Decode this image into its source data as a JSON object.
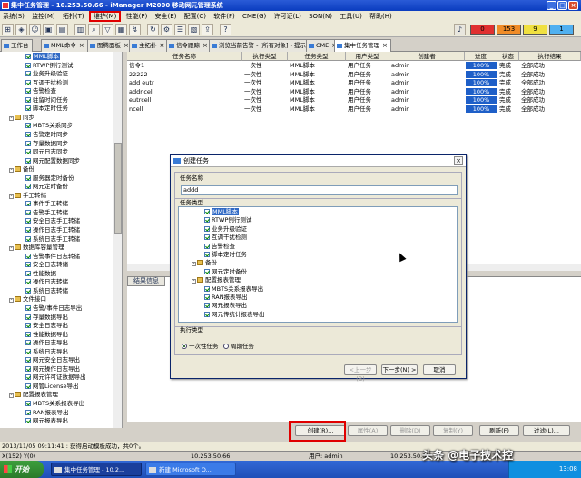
{
  "window": {
    "title": "集中任务管理 - 10.253.50.66 - iManager M2000 移动网元管理系统"
  },
  "menu": [
    "系统(S)",
    "监控(M)",
    "拓扑(T)",
    "维护(M)",
    "性能(P)",
    "安全(E)",
    "配置(C)",
    "软件(F)",
    "CME(G)",
    "许可证(L)",
    "SON(N)",
    "工具(U)",
    "帮助(H)"
  ],
  "alarm_counts": [
    {
      "value": "0",
      "color": "#e03030"
    },
    {
      "value": "153",
      "color": "#f08c28"
    },
    {
      "value": "9",
      "color": "#f0e040"
    },
    {
      "value": "1",
      "color": "#50b0f0"
    }
  ],
  "tabs": [
    {
      "label": "工作台"
    },
    {
      "label": "MML命令"
    },
    {
      "label": "图腾面板"
    },
    {
      "label": "主拓扑"
    },
    {
      "label": "信令跟踪"
    },
    {
      "label": "浏览当前告警 - [所有对象] - 提示"
    },
    {
      "label": "CME"
    },
    {
      "label": "集中任务管理"
    }
  ],
  "tree": [
    {
      "label": "MML脚本",
      "kind": "leaf",
      "sel": true
    },
    {
      "label": "RTWP例行测试",
      "kind": "leaf"
    },
    {
      "label": "业务升级验证",
      "kind": "leaf"
    },
    {
      "label": "互调干扰检测",
      "kind": "leaf"
    },
    {
      "label": "告警检查",
      "kind": "leaf"
    },
    {
      "label": "驻留时间任务",
      "kind": "leaf"
    },
    {
      "label": "脚本定时任务",
      "kind": "leaf"
    },
    {
      "label": "同步",
      "kind": "folder"
    },
    {
      "label": "MBTS关系同步",
      "kind": "leaf"
    },
    {
      "label": "告警定时同步",
      "kind": "leaf"
    },
    {
      "label": "存量数据同步",
      "kind": "leaf"
    },
    {
      "label": "同元日志同步",
      "kind": "leaf"
    },
    {
      "label": "网元配置数据同步",
      "kind": "leaf"
    },
    {
      "label": "备份",
      "kind": "folder"
    },
    {
      "label": "服务器定时备份",
      "kind": "leaf"
    },
    {
      "label": "网元定时备份",
      "kind": "leaf"
    },
    {
      "label": "手工转储",
      "kind": "folder"
    },
    {
      "label": "事件手工转储",
      "kind": "leaf"
    },
    {
      "label": "告警手工转储",
      "kind": "leaf"
    },
    {
      "label": "安全日志手工转储",
      "kind": "leaf"
    },
    {
      "label": "操作日志手工转储",
      "kind": "leaf"
    },
    {
      "label": "系统日志手工转储",
      "kind": "leaf"
    },
    {
      "label": "数据库容量管理",
      "kind": "folder"
    },
    {
      "label": "告警事件日志转储",
      "kind": "leaf"
    },
    {
      "label": "安全日志转储",
      "kind": "leaf"
    },
    {
      "label": "性能数据",
      "kind": "leaf"
    },
    {
      "label": "操作日志转储",
      "kind": "leaf"
    },
    {
      "label": "系统日志转储",
      "kind": "leaf"
    },
    {
      "label": "文件接口",
      "kind": "folder"
    },
    {
      "label": "告警/事件日志导出",
      "kind": "leaf"
    },
    {
      "label": "存量数据导出",
      "kind": "leaf"
    },
    {
      "label": "安全日志导出",
      "kind": "leaf"
    },
    {
      "label": "性能数据导出",
      "kind": "leaf"
    },
    {
      "label": "操作日志导出",
      "kind": "leaf"
    },
    {
      "label": "系统日志导出",
      "kind": "leaf"
    },
    {
      "label": "网元安全日志导出",
      "kind": "leaf"
    },
    {
      "label": "网元操作日志导出",
      "kind": "leaf"
    },
    {
      "label": "网元许可证数据导出",
      "kind": "leaf"
    },
    {
      "label": "网管License导出",
      "kind": "leaf"
    },
    {
      "label": "配置报表管理",
      "kind": "folder"
    },
    {
      "label": "MBTS关系报表导出",
      "kind": "leaf"
    },
    {
      "label": "RAN报表导出",
      "kind": "leaf"
    },
    {
      "label": "网元报表导出",
      "kind": "leaf"
    }
  ],
  "table": {
    "headers": [
      "任务名称",
      "执行类型",
      "任务类型",
      "用户类型",
      "创建者",
      "进度",
      "状态",
      "执行结果"
    ],
    "rows": [
      [
        "信令1",
        "一次性",
        "MML脚本",
        "用户任务",
        "admin",
        "100%",
        "完成",
        "全部成功"
      ],
      [
        "22222",
        "一次性",
        "MML脚本",
        "用户任务",
        "admin",
        "100%",
        "完成",
        "全部成功"
      ],
      [
        "add eutr",
        "一次性",
        "MML脚本",
        "用户任务",
        "admin",
        "100%",
        "完成",
        "全部成功"
      ],
      [
        "addncell",
        "一次性",
        "MML脚本",
        "用户任务",
        "admin",
        "100%",
        "完成",
        "全部成功"
      ],
      [
        "eutrcell",
        "一次性",
        "MML脚本",
        "用户任务",
        "admin",
        "100%",
        "完成",
        "全部成功"
      ],
      [
        "ncell",
        "一次性",
        "MML脚本",
        "用户任务",
        "admin",
        "100%",
        "完成",
        "全部成功"
      ]
    ]
  },
  "result_tab": "结果信息",
  "bottom_buttons": [
    {
      "label": "创建(R)...",
      "disabled": false
    },
    {
      "label": "属性(A)",
      "disabled": true
    },
    {
      "label": "删除(D)",
      "disabled": true
    },
    {
      "label": "复制(Y)",
      "disabled": true
    },
    {
      "label": "刷新(F)",
      "disabled": false
    },
    {
      "label": "过滤(L)...",
      "disabled": false
    }
  ],
  "dialog": {
    "title": "创建任务",
    "name_label": "任务名称",
    "name_value": "addd",
    "type_label": "任务类型",
    "type_tree": [
      {
        "label": "MML脚本",
        "kind": "leaf",
        "sel": true
      },
      {
        "label": "RTWP例行测试",
        "kind": "leaf"
      },
      {
        "label": "业务升级验证",
        "kind": "leaf"
      },
      {
        "label": "互调干扰检测",
        "kind": "leaf"
      },
      {
        "label": "告警检查",
        "kind": "leaf"
      },
      {
        "label": "脚本定时任务",
        "kind": "leaf"
      },
      {
        "label": "备份",
        "kind": "folder"
      },
      {
        "label": "网元定时备份",
        "kind": "leaf"
      },
      {
        "label": "配置报表管理",
        "kind": "folder"
      },
      {
        "label": "MBTS关系报表导出",
        "kind": "leaf"
      },
      {
        "label": "RAN报表导出",
        "kind": "leaf"
      },
      {
        "label": "网元报表导出",
        "kind": "leaf"
      },
      {
        "label": "网元传统计报表导出",
        "kind": "leaf"
      }
    ],
    "exec_label": "执行类型",
    "exec_once": "一次性任务",
    "exec_periodic": "周期任务",
    "btn_prev": "<上一步(B)",
    "btn_next": "下一步(N) >",
    "btn_cancel": "取消"
  },
  "status_line": "2013/11/05 09:11:41 : 获得启动模板成功，共0个。",
  "status_bar": {
    "coords": "X(152) Y(0)",
    "server": "10.253.50.66",
    "user": "用户: admin",
    "ip": "10.253.50.66"
  },
  "taskbar": {
    "start": "开始",
    "tasks": [
      "集中任务管理 - 10.2...",
      "新建 Microsoft O..."
    ],
    "time": "13:08"
  },
  "watermark": "头条 @电子技术控"
}
